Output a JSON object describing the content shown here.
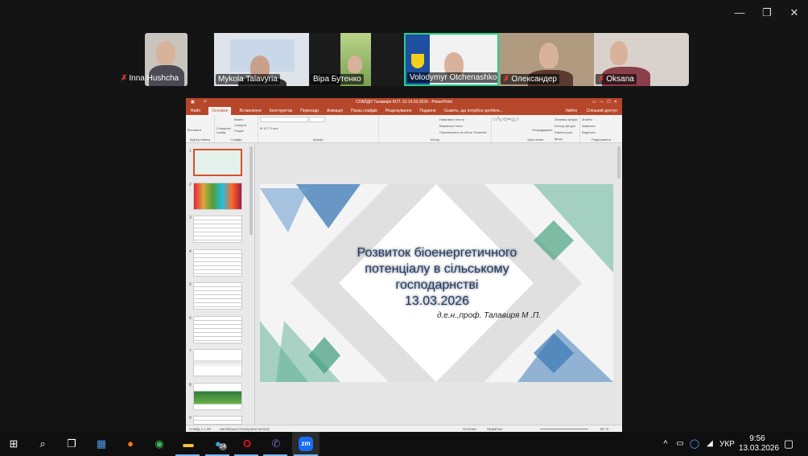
{
  "window_controls": {
    "minimize": "—",
    "restore": "❐",
    "close": "✕"
  },
  "participants": [
    {
      "name": "Inna Hushcha",
      "muted": true
    },
    {
      "name": "Mykola Talavyria",
      "muted": false
    },
    {
      "name": "Віра Бутенко",
      "muted": false
    },
    {
      "name": "Volodymyr Otchenashko",
      "muted": false,
      "active_speaker": true
    },
    {
      "name": "Олександер",
      "muted": true
    },
    {
      "name": "Oksana",
      "muted": true
    }
  ],
  "powerpoint": {
    "title": "СЛАЙДИ Талавиря М.П. 13-14.03.2026 - PowerPoint",
    "tabs": [
      "Файл",
      "Основне",
      "Вставлення",
      "Конструктор",
      "Переходи",
      "Анімація",
      "Показ слайдів",
      "Рецензування",
      "Подання",
      "Скажіть, що потрібно зробити..."
    ],
    "account": "Увійти",
    "share": "Спільний доступ",
    "groups": [
      "Буфер обміну",
      "Слайди",
      "Шрифт",
      "Абзац",
      "Креслення",
      "Редагування"
    ],
    "ribbon_items": {
      "paste": "Вставити",
      "new_slide": "Створити слайд",
      "layout": "Макет",
      "reset": "Скинути",
      "section": "Розділ",
      "text_direction": "Напрямок тексту",
      "align_text": "Вирівняти текст",
      "smartart": "Перетворити на об'єкт SmartArt",
      "arrange": "Упорядкувати",
      "quick_styles": "Експрес-стилі",
      "fill": "Заливка фігури",
      "outline": "Контур фігури",
      "effects": "Ефекти для фігур",
      "find": "Знайти",
      "replace": "Замінити",
      "select": "Виділити"
    },
    "slide_numbers": [
      "1",
      "2",
      "3",
      "4",
      "5",
      "6",
      "7",
      "8",
      "9"
    ],
    "slide": {
      "title": "Розвиток біоенергетичного потенціалу в сільському господарнстві",
      "date": "13.03.2026",
      "author": "д.е.н.,проф. Талавиря М .П."
    },
    "status": {
      "slide": "Слайд 1 з 26",
      "language": "англійська (Сполучені Штати)",
      "notes": "Нотатки",
      "comments": "Примітки",
      "zoom": "81 %"
    },
    "accent": "#b7472a"
  },
  "taskbar": {
    "apps": [
      "windows-start",
      "search",
      "task-view",
      "microsoft-store",
      "firefox",
      "chrome",
      "file-explorer",
      "telegram",
      "opera",
      "viber",
      "zoom"
    ],
    "telegram_badge": "24",
    "zoom_label": "zm",
    "language": "УКР",
    "time": "9:56",
    "date": "13.03.2026"
  }
}
